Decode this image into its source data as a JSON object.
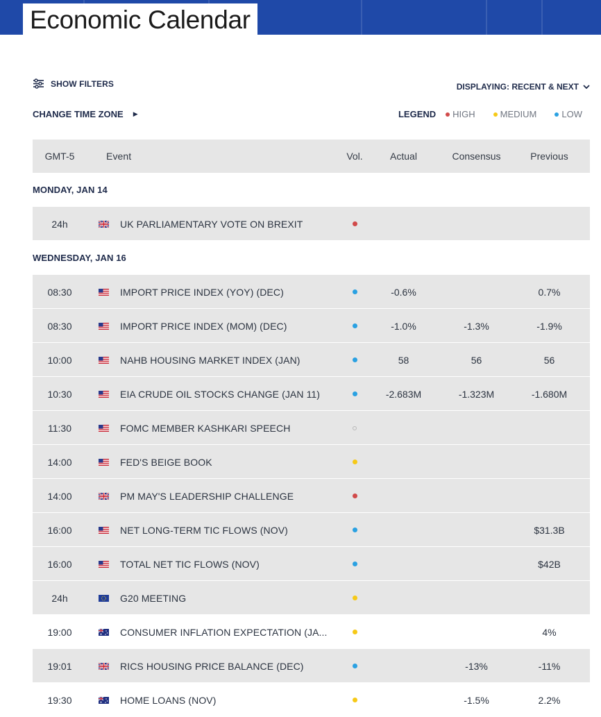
{
  "header": {
    "title": "Economic Calendar"
  },
  "controls": {
    "show_filters": "SHOW FILTERS",
    "change_time_zone": "CHANGE TIME ZONE",
    "displaying": "DISPLAYING: RECENT & NEXT",
    "arrow": "▶"
  },
  "legend": {
    "title": "LEGEND",
    "high": "HIGH",
    "medium": "MEDIUM",
    "low": "LOW",
    "colors": {
      "high": "#d14a4a",
      "medium": "#f6c917",
      "low": "#2aa1e2"
    }
  },
  "table": {
    "headers": {
      "time": "GMT-5",
      "event": "Event",
      "vol": "Vol.",
      "actual": "Actual",
      "consensus": "Consensus",
      "previous": "Previous"
    },
    "days": [
      {
        "label": "MONDAY, JAN 14",
        "events": [
          {
            "time": "24h",
            "flag": "uk-flag-icon",
            "event": "UK PARLIAMENTARY VOTE ON BREXIT",
            "vol": "high",
            "actual": "",
            "consensus": "",
            "previous": "",
            "shade": true
          }
        ]
      },
      {
        "label": "WEDNESDAY, JAN 16",
        "events": [
          {
            "time": "08:30",
            "flag": "us-flag-icon",
            "event": "IMPORT PRICE INDEX (YOY) (DEC)",
            "vol": "low",
            "actual": "-0.6%",
            "consensus": "",
            "previous": "0.7%",
            "shade": true
          },
          {
            "time": "08:30",
            "flag": "us-flag-icon",
            "event": "IMPORT PRICE INDEX (MOM) (DEC)",
            "vol": "low",
            "actual": "-1.0%",
            "consensus": "-1.3%",
            "previous": "-1.9%",
            "shade": true
          },
          {
            "time": "10:00",
            "flag": "us-flag-icon",
            "event": "NAHB HOUSING MARKET INDEX (JAN)",
            "vol": "low",
            "actual": "58",
            "consensus": "56",
            "previous": "56",
            "shade": true
          },
          {
            "time": "10:30",
            "flag": "us-flag-icon",
            "event": "EIA CRUDE OIL STOCKS CHANGE (JAN 11)",
            "vol": "low",
            "actual": "-2.683M",
            "consensus": "-1.323M",
            "previous": "-1.680M",
            "shade": true
          },
          {
            "time": "11:30",
            "flag": "us-flag-icon",
            "event": "FOMC MEMBER KASHKARI SPEECH",
            "vol": "none",
            "actual": "",
            "consensus": "",
            "previous": "",
            "shade": true
          },
          {
            "time": "14:00",
            "flag": "us-flag-icon",
            "event": "FED'S BEIGE BOOK",
            "vol": "medium",
            "actual": "",
            "consensus": "",
            "previous": "",
            "shade": true
          },
          {
            "time": "14:00",
            "flag": "uk-flag-icon",
            "event": "PM MAY'S LEADERSHIP CHALLENGE",
            "vol": "high",
            "actual": "",
            "consensus": "",
            "previous": "",
            "shade": true
          },
          {
            "time": "16:00",
            "flag": "us-flag-icon",
            "event": "NET LONG-TERM TIC FLOWS (NOV)",
            "vol": "low",
            "actual": "",
            "consensus": "",
            "previous": "$31.3B",
            "shade": true
          },
          {
            "time": "16:00",
            "flag": "us-flag-icon",
            "event": "TOTAL NET TIC FLOWS (NOV)",
            "vol": "low",
            "actual": "",
            "consensus": "",
            "previous": "$42B",
            "shade": true
          },
          {
            "time": "24h",
            "flag": "eu-flag-icon",
            "event": "G20 MEETING",
            "vol": "medium",
            "actual": "",
            "consensus": "",
            "previous": "",
            "shade": true
          },
          {
            "time": "19:00",
            "flag": "au-flag-icon",
            "event": "CONSUMER INFLATION EXPECTATION (JA...",
            "vol": "medium",
            "actual": "",
            "consensus": "",
            "previous": "4%",
            "shade": false
          },
          {
            "time": "19:01",
            "flag": "uk-flag-icon",
            "event": "RICS HOUSING PRICE BALANCE (DEC)",
            "vol": "low",
            "actual": "",
            "consensus": "-13%",
            "previous": "-11%",
            "shade": true
          },
          {
            "time": "19:30",
            "flag": "au-flag-icon",
            "event": "HOME LOANS (NOV)",
            "vol": "medium",
            "actual": "",
            "consensus": "-1.5%",
            "previous": "2.2%",
            "shade": false
          }
        ]
      }
    ]
  }
}
